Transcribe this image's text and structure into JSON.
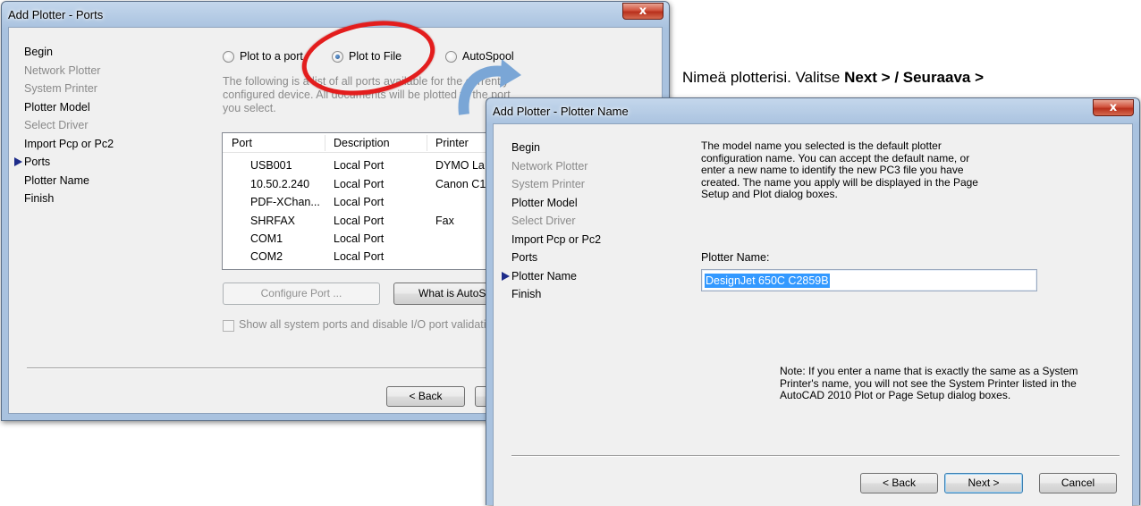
{
  "ports_window": {
    "title": "Add Plotter - Ports",
    "close_glyph": "x",
    "nav": [
      "Begin",
      "Network Plotter",
      "System Printer",
      "Plotter Model",
      "Select Driver",
      "Import Pcp or Pc2",
      "Ports",
      "Plotter Name",
      "Finish"
    ],
    "radios": {
      "port": "Plot to a port",
      "file": "Plot to File",
      "spool": "AutoSpool",
      "selected": "Plot to File"
    },
    "description_lines": [
      "The following is a list of all ports available for the currently",
      "configured device. All documents will be plotted to the port",
      "you select."
    ],
    "table": {
      "headers": [
        "Port",
        "Description",
        "Printer"
      ],
      "rows": [
        [
          "USB001",
          "Local Port",
          "DYMO La"
        ],
        [
          "10.50.2.240",
          "Local Port",
          "Canon C1"
        ],
        [
          "PDF-XChan...",
          "Local Port",
          ""
        ],
        [
          "SHRFAX",
          "Local Port",
          "Fax"
        ],
        [
          "COM1",
          "Local Port",
          ""
        ],
        [
          "COM2",
          "Local Port",
          ""
        ]
      ]
    },
    "configure_port": "Configure Port ...",
    "what_is": "What is AutoSpool?",
    "show_all": "Show all system ports and disable I/O port validation",
    "back": "< Back"
  },
  "caption": {
    "prefix": "Nimeä plotterisi. Valitse ",
    "bold": "Next > / Seuraava >"
  },
  "name_window": {
    "title": "Add Plotter - Plotter Name",
    "close_glyph": "x",
    "nav": [
      "Begin",
      "Network Plotter",
      "System Printer",
      "Plotter Model",
      "Select Driver",
      "Import Pcp or Pc2",
      "Ports",
      "Plotter Name",
      "Finish"
    ],
    "intro_lines": [
      "The model name you selected is the default plotter",
      "configuration name. You can accept the default name, or",
      "enter a new name to identify the new PC3 file you have",
      "created. The name you apply will be displayed in the Page",
      "Setup and Plot dialog boxes."
    ],
    "plotter_name_label": "Plotter Name:",
    "plotter_name_value": "DesignJet 650C C2859B",
    "note_lines": [
      "Note: If you enter a name that is exactly the same as a System",
      "Printer's name, you will not see the System Printer listed in the",
      "AutoCAD 2010 Plot or Page Setup dialog boxes."
    ],
    "back": "< Back",
    "next": "Next >",
    "cancel": "Cancel"
  },
  "colors": {
    "annotation_red": "#e31d1d",
    "arrow_blue": "#7aa6d6",
    "selection_blue": "#3399ff"
  }
}
